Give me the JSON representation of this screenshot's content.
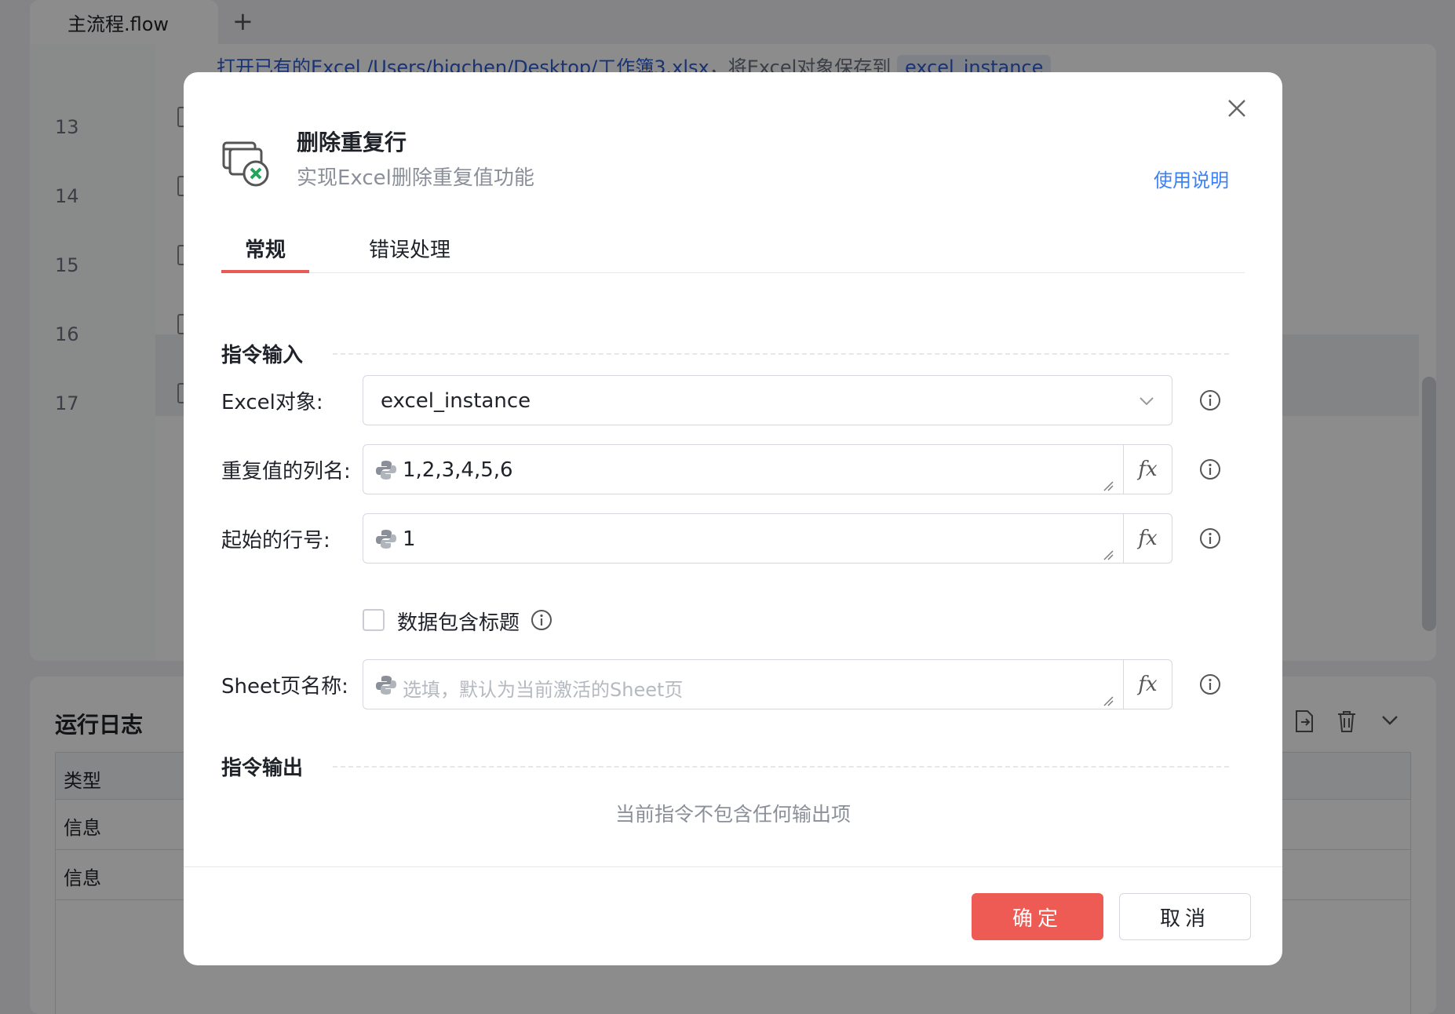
{
  "background": {
    "file_tab": "主流程.flow",
    "add_tab": "+",
    "line_numbers": [
      "13",
      "14",
      "15",
      "16",
      "17"
    ],
    "code_line": {
      "prefix": "打开已有的Excel /Users/bigchen/Desktop/工作簿3.xlsx",
      "middle": "，将Excel对象保存到",
      "var": "excel_instance"
    },
    "log": {
      "title": "运行日志",
      "column_type": "类型",
      "rows": [
        "信息",
        "信息"
      ]
    }
  },
  "dialog": {
    "title": "删除重复行",
    "subtitle": "实现Excel删除重复值功能",
    "help_link": "使用说明",
    "tabs": [
      "常规",
      "错误处理"
    ],
    "section_input": "指令输入",
    "section_output": "指令输出",
    "fields": {
      "excel_object": {
        "label": "Excel对象:",
        "value": "excel_instance"
      },
      "columns": {
        "label": "重复值的列名:",
        "value": "1,2,3,4,5,6"
      },
      "start_row": {
        "label": "起始的行号:",
        "value": "1"
      },
      "sheet_name": {
        "label": "Sheet页名称:",
        "value": "",
        "placeholder": "选填，默认为当前激活的Sheet页"
      }
    },
    "fx_label": "fx",
    "checkbox": {
      "label": "数据包含标题",
      "checked": false
    },
    "empty_output": "当前指令不包含任何输出项",
    "confirm": "确定",
    "cancel": "取消"
  },
  "colors": {
    "accent": "#ee5b55",
    "link": "#3b82f6",
    "code_blue": "#2f5bd3",
    "excel_green": "#22a45a"
  }
}
